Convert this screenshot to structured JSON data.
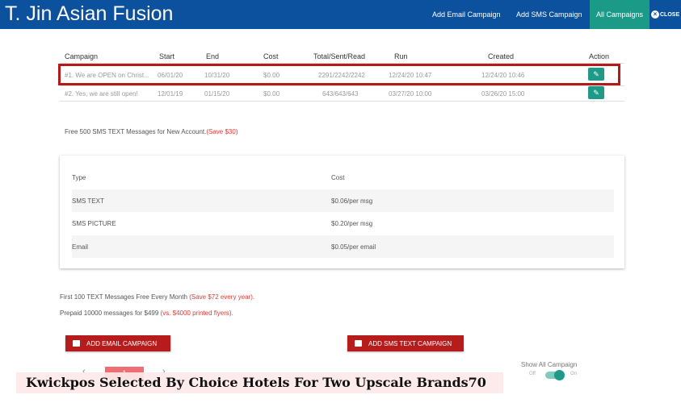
{
  "header": {
    "title": "T. Jin Asian Fusion",
    "nav": [
      "Add Email Campaign",
      "Add SMS Campaign",
      "All Campaigns"
    ],
    "close": "CLOSE"
  },
  "table": {
    "columns": [
      "Campaign",
      "Start",
      "End",
      "Cost",
      "Total/Sent/Read",
      "Run",
      "Created",
      "Action"
    ],
    "rows": [
      {
        "campaign": "#1. We are OPEN on Christ...",
        "start": "06/01/20",
        "end": "10/31/20",
        "cost": "$0.00",
        "tsr": "2291/2242/2242",
        "run": "12/24/20 10:47",
        "created": "12/24/20 10:46"
      },
      {
        "campaign": "#2. Yes, we are still open!",
        "start": "12/01/19",
        "end": "01/15/20",
        "cost": "$0.00",
        "tsr": "643/643/643",
        "run": "03/27/20 10:00",
        "created": "03/26/20 15:00"
      }
    ]
  },
  "promo": {
    "free": "Free 500 SMS TEXT Messages for New Account.",
    "free_save": "(Save $30)",
    "monthly": "First 100 TEXT Messages Free Every Month ",
    "monthly_save": "(Save $72 every year)",
    "monthly_end": ".",
    "prepaid": "Prepaid 10000 messages for $499 ",
    "prepaid_save": "(vs. $4000 printed flyers)",
    "prepaid_end": "."
  },
  "pricing": {
    "headers": [
      "Type",
      "Cost"
    ],
    "rows": [
      [
        "SMS TEXT",
        "$0.06/per msg"
      ],
      [
        "SMS PICTURE",
        "$0.20/per msg"
      ],
      [
        "Email",
        "$0.05/per email"
      ]
    ]
  },
  "buttons": {
    "email": "ADD EMAIL CAMPAIGN",
    "sms": "ADD SMS TEXT CAMPAIGN"
  },
  "pagination": {
    "prev": "‹",
    "page": "1",
    "next": "›"
  },
  "toggle": {
    "label": "Show All Campaign",
    "off": "Off",
    "on": "On",
    "state": true
  },
  "caption": "Kwickpos Selected By Choice Hotels For Two Upscale Brands70",
  "colors": {
    "header": "#0c519d",
    "accent": "#1a9a87",
    "button": "#b71c1c",
    "highlight": "#b31b1b"
  }
}
